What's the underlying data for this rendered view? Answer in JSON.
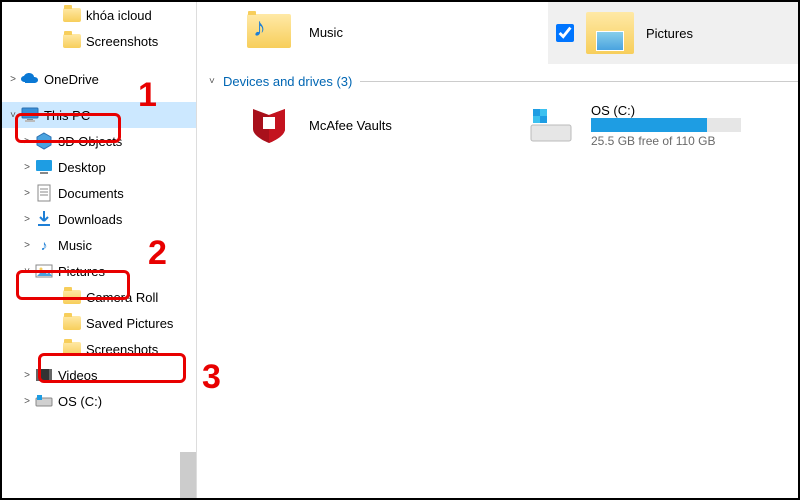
{
  "sidebar": {
    "items": [
      {
        "label": "khóa icloud",
        "level": 2,
        "chevron": "",
        "icon": "folder"
      },
      {
        "label": "Screenshots",
        "level": 2,
        "chevron": "",
        "icon": "folder"
      },
      {
        "label": "OneDrive",
        "level": 0,
        "chevron": ">",
        "icon": "onedrive"
      },
      {
        "label": "This PC",
        "level": 0,
        "chevron": "v",
        "icon": "pc",
        "selected": true
      },
      {
        "label": "3D Objects",
        "level": 1,
        "chevron": ">",
        "icon": "3d"
      },
      {
        "label": "Desktop",
        "level": 1,
        "chevron": ">",
        "icon": "desktop"
      },
      {
        "label": "Documents",
        "level": 1,
        "chevron": ">",
        "icon": "documents"
      },
      {
        "label": "Downloads",
        "level": 1,
        "chevron": ">",
        "icon": "downloads"
      },
      {
        "label": "Music",
        "level": 1,
        "chevron": ">",
        "icon": "music"
      },
      {
        "label": "Pictures",
        "level": 1,
        "chevron": "v",
        "icon": "pictures"
      },
      {
        "label": "Camera Roll",
        "level": 2,
        "chevron": "",
        "icon": "folder"
      },
      {
        "label": "Saved Pictures",
        "level": 2,
        "chevron": "",
        "icon": "folder"
      },
      {
        "label": "Screenshots",
        "level": 2,
        "chevron": "",
        "icon": "folder"
      },
      {
        "label": "Videos",
        "level": 1,
        "chevron": ">",
        "icon": "videos"
      },
      {
        "label": "OS (C:)",
        "level": 1,
        "chevron": ">",
        "icon": "drive"
      }
    ]
  },
  "main": {
    "music_label": "Music",
    "section_label": "Devices and drives (3)",
    "mcafee_label": "McAfee Vaults",
    "drive": {
      "name": "OS (C:)",
      "subtitle": "25.5 GB free of 110 GB",
      "fill_percent": 77
    }
  },
  "preview": {
    "label": "Pictures",
    "checked": true
  },
  "annotations": {
    "n1": "1",
    "n2": "2",
    "n3": "3"
  }
}
